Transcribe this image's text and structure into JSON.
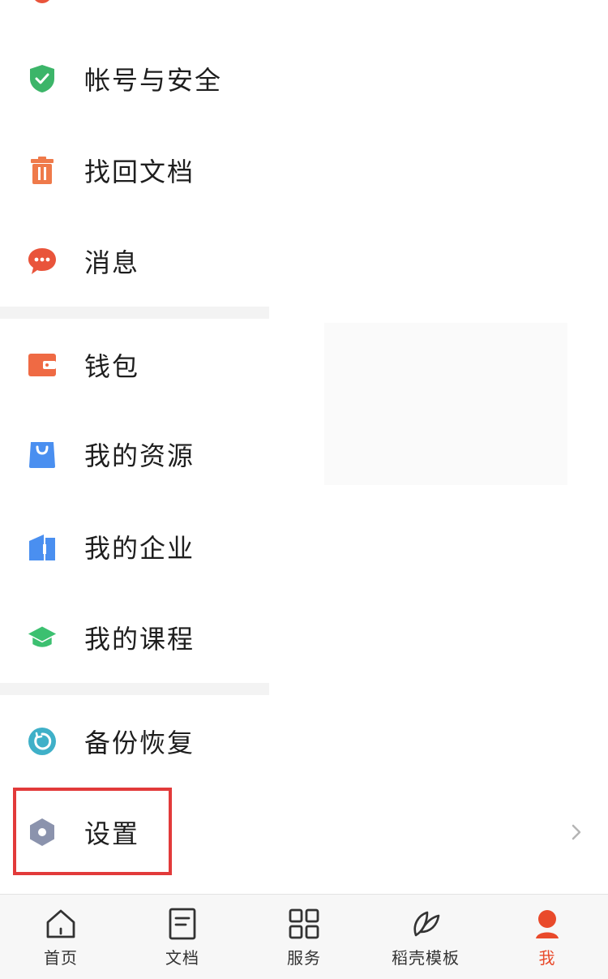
{
  "menu": {
    "items": [
      {
        "label": "帐号与安全",
        "icon": "shield-check-icon",
        "color": "#3cb569"
      },
      {
        "label": "找回文档",
        "icon": "trash-icon",
        "color": "#ef7a4a"
      },
      {
        "label": "消息",
        "icon": "chat-bubble-icon",
        "color": "#e9543b"
      },
      {
        "label": "钱包",
        "icon": "wallet-icon",
        "color": "#ef6a44"
      },
      {
        "label": "我的资源",
        "icon": "shopping-bag-icon",
        "color": "#4a8ff0"
      },
      {
        "label": "我的企业",
        "icon": "building-icon",
        "color": "#4a8ff0"
      },
      {
        "label": "我的课程",
        "icon": "graduation-cap-icon",
        "color": "#3cc070"
      },
      {
        "label": "备份恢复",
        "icon": "restore-icon",
        "color": "#3fb0c8"
      },
      {
        "label": "设置",
        "icon": "settings-hexagon-icon",
        "color": "#8b93ad"
      }
    ]
  },
  "tabbar": {
    "tabs": [
      {
        "label": "首页",
        "icon": "home-icon"
      },
      {
        "label": "文档",
        "icon": "document-icon"
      },
      {
        "label": "服务",
        "icon": "grid-icon"
      },
      {
        "label": "稻壳模板",
        "icon": "leaf-icon"
      },
      {
        "label": "我",
        "icon": "user-icon",
        "active": true
      }
    ]
  },
  "colors": {
    "highlight_border": "#e23a3a",
    "active_tab": "#e94a2b"
  }
}
